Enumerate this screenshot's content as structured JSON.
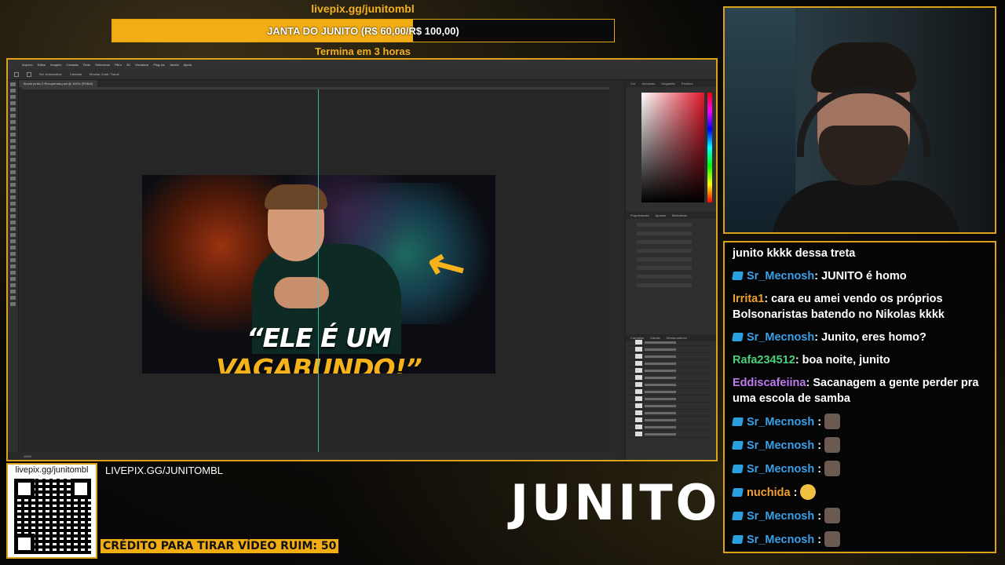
{
  "goal": {
    "url": "livepix.gg/junitombl",
    "label": "JANTA DO JUNITO (R$ 60,00/R$ 100,00)",
    "progress": 0.6,
    "subtitle": "Termina em 3 horas",
    "color": "#f2ad14"
  },
  "photoshop": {
    "menu": [
      "Arquivo",
      "Editar",
      "Imagem",
      "Camada",
      "Texto",
      "Selecionar",
      "Filtro",
      "3D",
      "Visualizar",
      "Plug-ins",
      "Janela",
      "Ajuda"
    ],
    "tab": "thumb junito 2-Recuperado.psd @ 100% (RGB/8)",
    "options": [
      "Sel. Automática:",
      "Camada",
      "Mostrar Contr. Transf."
    ],
    "panel_tabs": [
      "Cor",
      "Amostras",
      "Degradês",
      "Padrões"
    ],
    "props_tabs": [
      "Propriedades",
      "Ajustes",
      "Bibliotecas"
    ],
    "layers_tabs": [
      "Camadas",
      "Canais",
      "Demarcadores"
    ],
    "status": "100%",
    "thumbnail": {
      "title_white": "“ELE É UM ",
      "title_highlight": "VAGABUNDO!”",
      "arrow": "↖"
    }
  },
  "chat": [
    {
      "badge": false,
      "user": "",
      "user_color": "#ffffff",
      "text": "junito kkkk dessa treta"
    },
    {
      "badge": true,
      "user": "Sr_Mecnosh",
      "user_color": "#3aa0e8",
      "text": ": JUNITO é homo"
    },
    {
      "badge": false,
      "user": "Irrita1",
      "user_color": "#f0a030",
      "text": ": cara eu amei vendo os próprios Bolsonaristas batendo no Nikolas kkkk"
    },
    {
      "badge": true,
      "user": "Sr_Mecnosh",
      "user_color": "#3aa0e8",
      "text": ": Junito, eres homo?"
    },
    {
      "badge": false,
      "user": "Rafa234512",
      "user_color": "#4ad07a",
      "text": ": boa noite, junito"
    },
    {
      "badge": false,
      "user": "Eddiscafeiina",
      "user_color": "#c07af0",
      "text": ": Sacanagem a gente perder pra uma escola de samba"
    },
    {
      "badge": true,
      "user": "Sr_Mecnosh",
      "user_color": "#3aa0e8",
      "text": " :",
      "emote": "emote-1"
    },
    {
      "badge": true,
      "user": "Sr_Mecnosh",
      "user_color": "#3aa0e8",
      "text": " :",
      "emote": "emote-2"
    },
    {
      "badge": true,
      "user": "Sr_Mecnosh",
      "user_color": "#3aa0e8",
      "text": " :",
      "emote": "emote-3"
    },
    {
      "badge": true,
      "user": "nuchida",
      "user_color": "#f0a030",
      "text": " :",
      "emote": "clap-emoji"
    },
    {
      "badge": true,
      "user": "Sr_Mecnosh",
      "user_color": "#3aa0e8",
      "text": " :",
      "emote": "emote-4"
    },
    {
      "badge": true,
      "user": "Sr_Mecnosh",
      "user_color": "#3aa0e8",
      "text": " :",
      "emote": "emote-5"
    }
  ],
  "qr": {
    "label": "livepix.gg/junitombl"
  },
  "bottom": {
    "livepix_text": "LIVEPIX.GG/JUNITOMBL",
    "credit": "CRÉDITO PARA TIRAR VÍDEO RUIM: 50",
    "logo": "JUNITO"
  }
}
